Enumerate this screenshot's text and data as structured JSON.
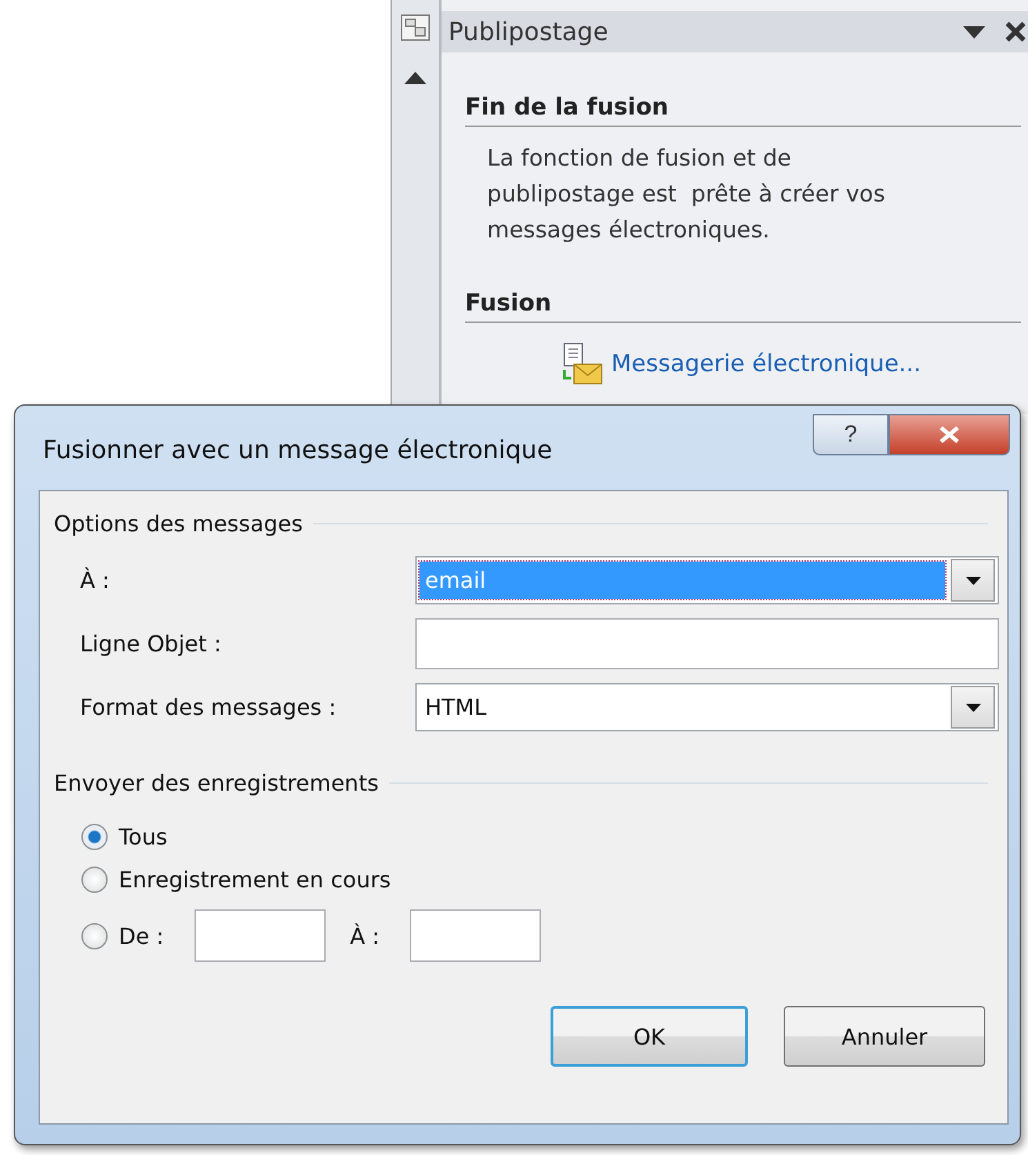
{
  "task_pane": {
    "title": "Publipostage",
    "sections": [
      {
        "heading": "Fin de la fusion",
        "text": "La fonction de fusion et de publipostage est  prête à créer vos messages électroniques."
      },
      {
        "heading": "Fusion",
        "link": "Messagerie électronique..."
      }
    ]
  },
  "dialog": {
    "title": "Fusionner avec un message électronique",
    "help": "?",
    "groups": [
      {
        "legend": "Options des messages",
        "fields": [
          {
            "kind": "combo",
            "label": "À :",
            "value": "email",
            "focused": true
          },
          {
            "kind": "text",
            "label": "Ligne Objet :"
          },
          {
            "kind": "combo",
            "label": "Format des messages :",
            "value": "HTML",
            "focused": false
          }
        ]
      },
      {
        "legend": "Envoyer des enregistrements",
        "options": [
          {
            "label": "Tous",
            "selected": true
          },
          {
            "label": "Enregistrement en cours",
            "selected": false
          },
          {
            "label": "De :",
            "selected": false,
            "range_label": "À :"
          }
        ]
      }
    ],
    "buttons": [
      {
        "label": "OK",
        "default": true
      },
      {
        "label": "Annuler",
        "default": false
      }
    ]
  }
}
